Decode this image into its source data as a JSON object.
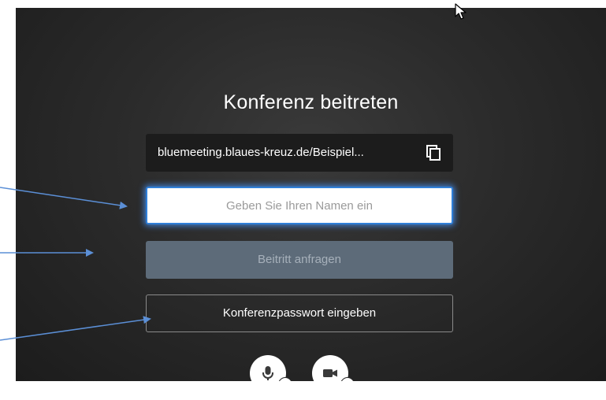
{
  "dialog": {
    "title": "Konferenz beitreten",
    "meeting_url": "bluemeeting.blaues-kreuz.de/Beispiel...",
    "name_input": {
      "placeholder": "Geben Sie Ihren Namen ein",
      "value": ""
    },
    "join_button_label": "Beitritt anfragen",
    "password_button_label": "Konferenzpasswort eingeben"
  },
  "icons": {
    "copy": "copy-icon",
    "microphone": "microphone-icon",
    "camera": "camera-icon",
    "chevron": "chevron-down-icon",
    "cursor": "mouse-cursor-icon"
  },
  "colors": {
    "background": "#2b2b2b",
    "url_box": "#1c1c1c",
    "input_focus_glow": "#2f7fd8",
    "join_button_disabled": "#5d6b79",
    "join_button_text": "#a6b0ba",
    "annotation_arrow": "#5b8fd6"
  }
}
